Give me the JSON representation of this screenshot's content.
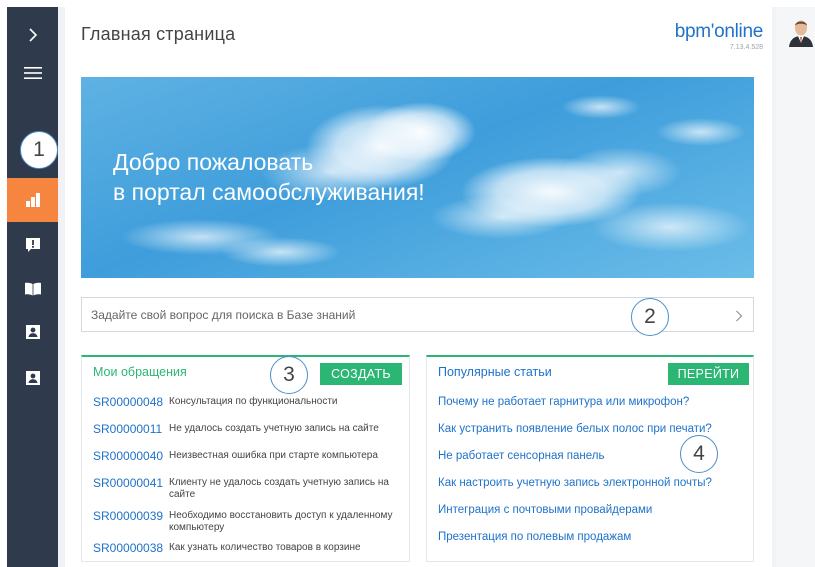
{
  "header": {
    "title": "Главная страница",
    "brand": "bpm'online",
    "version": "7.13.4.528"
  },
  "sidebar": {
    "items": [
      {
        "icon": "chevron-right-icon"
      },
      {
        "icon": "hamburger-menu-icon"
      },
      {
        "icon": "dashboard-chart-icon",
        "active": true
      },
      {
        "icon": "cases-alert-icon"
      },
      {
        "icon": "knowledge-base-book-icon"
      },
      {
        "icon": "contact-card-icon"
      },
      {
        "icon": "contact-card-icon"
      }
    ],
    "active_color": "#f5853f",
    "bg_color": "#2f3a4d"
  },
  "banner": {
    "line1": "Добро пожаловать",
    "line2": "в портал самообслуживания!"
  },
  "search": {
    "placeholder": "Задайте свой вопрос для поиска в Базе знаний"
  },
  "callouts": [
    "1",
    "2",
    "3",
    "4"
  ],
  "my_requests": {
    "title": "Мои обращения",
    "button": "СОЗДАТЬ",
    "items": [
      {
        "number": "SR00000048",
        "subject": "Консультация по функциональности"
      },
      {
        "number": "SR00000011",
        "subject": "Не удалось создать учетную запись на сайте"
      },
      {
        "number": "SR00000040",
        "subject": "Неизвестная ошибка при старте компьютера"
      },
      {
        "number": "SR00000041",
        "subject": "Клиенту не удалось создать учетную запись на сайте"
      },
      {
        "number": "SR00000039",
        "subject": "Необходимо восстановить доступ к удаленному компьютеру"
      },
      {
        "number": "SR00000038",
        "subject": "Как узнать количество товаров в корзине"
      }
    ]
  },
  "popular_articles": {
    "title": "Популярные статьи",
    "button": "ПЕРЕЙТИ",
    "items": [
      "Почему не работает гарнитура или микрофон?",
      "Как устранить появление белых полос при печати?",
      "Не работает сенсорная панель",
      "Как настроить учетную запись электронной почты?",
      "Интеграция с почтовыми провайдерами",
      "Презентация по полевым продажам"
    ]
  },
  "colors": {
    "accent_green": "#2bb673",
    "link_blue": "#1f72c9",
    "callout_border": "#4d8fc7"
  }
}
